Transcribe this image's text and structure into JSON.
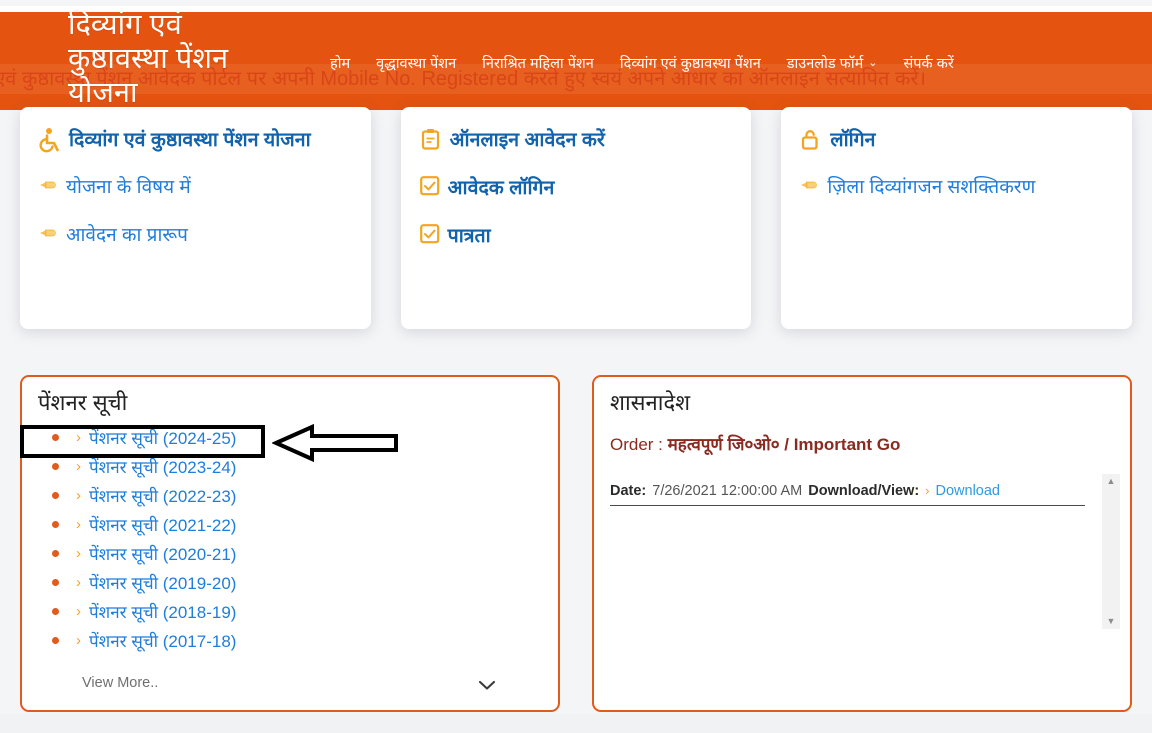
{
  "header": {
    "brand_title": "दिव्यांग एवं\nकुष्ठावस्था पेंशन\nयोजना",
    "marquee": "दिव्यांग एवं कुष्ठावस्था पेंशन आवेदक पोर्टल पर अपनी Mobile No. Registered करते हुए स्वयं अपने आधार का ऑनलाइन सत्यापित करें।",
    "nav": [
      {
        "label": "होम",
        "has_caret": false
      },
      {
        "label": "वृद्धावस्था पेंशन",
        "has_caret": false
      },
      {
        "label": "निराश्रित महिला पेंशन",
        "has_caret": false
      },
      {
        "label": "दिव्यांग एवं कुष्ठावस्था पेंशन",
        "has_caret": false
      },
      {
        "label": "डाउनलोड फॉर्म",
        "has_caret": true,
        "caret": "⌄"
      },
      {
        "label": "संपर्क करें",
        "has_caret": false
      }
    ]
  },
  "cards": [
    {
      "title": "दिव्यांग एवं कुष्ठावस्था पेंशन योजना",
      "title_icon": "wheelchair-icon",
      "links": [
        {
          "label": "योजना के विषय में",
          "icon": "pointing-finger-icon"
        },
        {
          "label": "आवेदन का प्रारूप",
          "icon": "pointing-finger-icon"
        }
      ]
    },
    {
      "title": "ऑनलाइन आवेदन करें",
      "title_icon": "clipboard-icon",
      "links": [
        {
          "label": "आवेदक लॉगिन",
          "icon": "checkbox-icon"
        },
        {
          "label": "पात्रता",
          "icon": "checkbox-icon"
        }
      ]
    },
    {
      "title": "लॉगिन",
      "title_icon": "open-padlock-icon",
      "links": [
        {
          "label": "ज़िला दिव्यांगजन सशक्तिकरण",
          "icon": "pointing-finger-icon"
        }
      ]
    }
  ],
  "pension_panel": {
    "title": "पेंशनर सूची",
    "items": [
      "पेंशनर सूची (2024-25)",
      "पेंशनर सूची (2023-24)",
      "पेंशनर सूची (2022-23)",
      "पेंशनर सूची (2021-22)",
      "पेंशनर सूची (2020-21)",
      "पेंशनर सूची (2019-20)",
      "पेंशनर सूची (2018-19)",
      "पेंशनर सूची (2017-18)"
    ],
    "highlighted_index": 0,
    "view_more": "View More..",
    "view_more_chevron": "⌄"
  },
  "orders_panel": {
    "title": "शासनादेश",
    "order_prefix": "Order : ",
    "order_name": "महत्वपूर्ण जि०ओ० / Important Go",
    "date_label": "Date:",
    "date_value": "7/26/2021 12:00:00 AM",
    "download_label": "Download/View:",
    "download_chevron": "›",
    "download_link": "Download",
    "scroll_up": "▲",
    "scroll_down": "▼"
  },
  "colors": {
    "header_orange": "#e4530f",
    "marquee_orange": "#e8601f",
    "panel_border": "#e05b1c",
    "link_blue": "#1f7ddc",
    "title_blue": "#1263ad",
    "icon_yellow": "#f3a51f",
    "order_red": "#8a2a21",
    "bullet_orange": "#e05b1c"
  }
}
